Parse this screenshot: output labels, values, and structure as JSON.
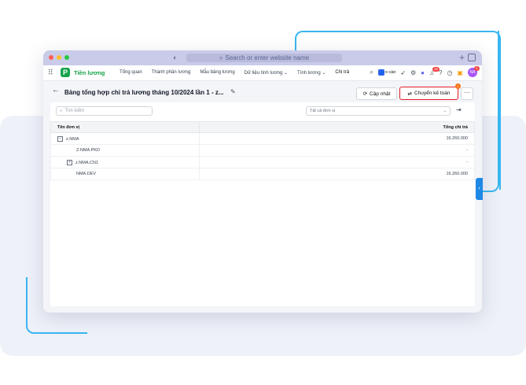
{
  "browser": {
    "url_placeholder": "Search or enter website name",
    "search_glyph": "⌕",
    "shield": "◐",
    "new_tab": "+"
  },
  "app": {
    "logo_letter": "P",
    "name": "Tiền lương",
    "apps_icon": "⠿"
  },
  "nav": {
    "items": [
      "Tổng quan",
      "Thành phần lương",
      "Mẫu bảng lương",
      "Dữ liệu tính lương ⌄",
      "Tính lương ⌄",
      "Chi trả"
    ],
    "cao_label": "o cáo",
    "notif_count": "10",
    "gift_count": "1",
    "avatar_initials": "NA"
  },
  "page": {
    "back": "←",
    "title": "Bảng tổng hợp chi trả lương tháng 10/2024 lần 1 - z...",
    "edit_icon": "✎",
    "update_label": "Cập nhật",
    "transfer_label": "Chuyển kế toán",
    "transfer_badge": "1",
    "more": "···"
  },
  "toolbar": {
    "search_placeholder": "Tìm kiếm",
    "filter_value": "Tất cả đơn vị"
  },
  "table": {
    "headers": {
      "unit": "Tên đơn vị",
      "total": "Tổng chi trả"
    },
    "rows": [
      {
        "unit": "z.NMA",
        "total": "16.260.000",
        "toggle": "−"
      },
      {
        "unit": "Z.NMA.PKD",
        "total": "-"
      },
      {
        "unit": "z.NMA.CN1",
        "total": "-",
        "toggle": "+"
      },
      {
        "unit": "NMA.DEV",
        "total": "16.260.000"
      }
    ]
  },
  "colors": {
    "brand": "#16a34a",
    "accent_line": "#38b6f1",
    "alert": "#e11d28",
    "side_tab": "#1e88e5"
  }
}
